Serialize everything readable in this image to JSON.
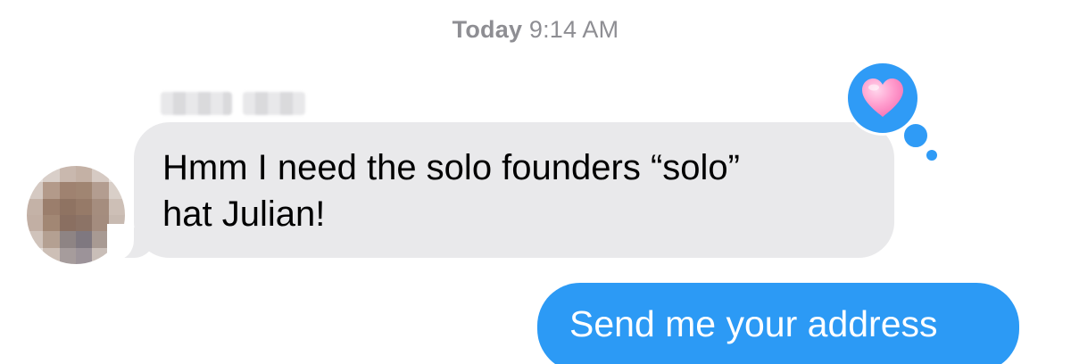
{
  "conversation": {
    "timestamp": {
      "day": "Today",
      "time": "9:14 AM"
    },
    "received_message": {
      "sender_name_blurred": true,
      "text": "Hmm I need the solo founders “solo”\nhat Julian!",
      "reaction": {
        "icon": "pink-heart-icon",
        "color": "#2f9bf6"
      }
    },
    "sent_message": {
      "text": "Send me your address"
    }
  },
  "colors": {
    "received_bubble": "#e9e9eb",
    "sent_bubble": "#2c9af5",
    "timestamp_text": "#8e8e93"
  }
}
